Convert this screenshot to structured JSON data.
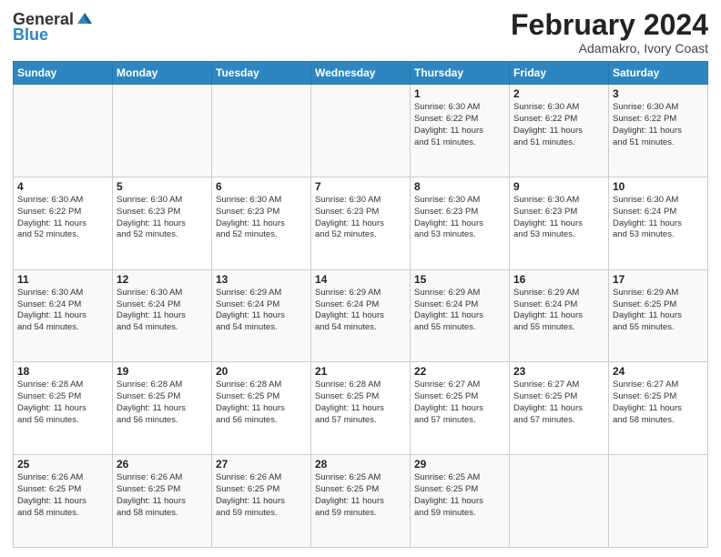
{
  "header": {
    "logo_line1": "General",
    "logo_line2": "Blue",
    "title": "February 2024",
    "subtitle": "Adamakro, Ivory Coast"
  },
  "weekdays": [
    "Sunday",
    "Monday",
    "Tuesday",
    "Wednesday",
    "Thursday",
    "Friday",
    "Saturday"
  ],
  "weeks": [
    [
      {
        "day": "",
        "info": ""
      },
      {
        "day": "",
        "info": ""
      },
      {
        "day": "",
        "info": ""
      },
      {
        "day": "",
        "info": ""
      },
      {
        "day": "1",
        "info": "Sunrise: 6:30 AM\nSunset: 6:22 PM\nDaylight: 11 hours\nand 51 minutes."
      },
      {
        "day": "2",
        "info": "Sunrise: 6:30 AM\nSunset: 6:22 PM\nDaylight: 11 hours\nand 51 minutes."
      },
      {
        "day": "3",
        "info": "Sunrise: 6:30 AM\nSunset: 6:22 PM\nDaylight: 11 hours\nand 51 minutes."
      }
    ],
    [
      {
        "day": "4",
        "info": "Sunrise: 6:30 AM\nSunset: 6:22 PM\nDaylight: 11 hours\nand 52 minutes."
      },
      {
        "day": "5",
        "info": "Sunrise: 6:30 AM\nSunset: 6:23 PM\nDaylight: 11 hours\nand 52 minutes."
      },
      {
        "day": "6",
        "info": "Sunrise: 6:30 AM\nSunset: 6:23 PM\nDaylight: 11 hours\nand 52 minutes."
      },
      {
        "day": "7",
        "info": "Sunrise: 6:30 AM\nSunset: 6:23 PM\nDaylight: 11 hours\nand 52 minutes."
      },
      {
        "day": "8",
        "info": "Sunrise: 6:30 AM\nSunset: 6:23 PM\nDaylight: 11 hours\nand 53 minutes."
      },
      {
        "day": "9",
        "info": "Sunrise: 6:30 AM\nSunset: 6:23 PM\nDaylight: 11 hours\nand 53 minutes."
      },
      {
        "day": "10",
        "info": "Sunrise: 6:30 AM\nSunset: 6:24 PM\nDaylight: 11 hours\nand 53 minutes."
      }
    ],
    [
      {
        "day": "11",
        "info": "Sunrise: 6:30 AM\nSunset: 6:24 PM\nDaylight: 11 hours\nand 54 minutes."
      },
      {
        "day": "12",
        "info": "Sunrise: 6:30 AM\nSunset: 6:24 PM\nDaylight: 11 hours\nand 54 minutes."
      },
      {
        "day": "13",
        "info": "Sunrise: 6:29 AM\nSunset: 6:24 PM\nDaylight: 11 hours\nand 54 minutes."
      },
      {
        "day": "14",
        "info": "Sunrise: 6:29 AM\nSunset: 6:24 PM\nDaylight: 11 hours\nand 54 minutes."
      },
      {
        "day": "15",
        "info": "Sunrise: 6:29 AM\nSunset: 6:24 PM\nDaylight: 11 hours\nand 55 minutes."
      },
      {
        "day": "16",
        "info": "Sunrise: 6:29 AM\nSunset: 6:24 PM\nDaylight: 11 hours\nand 55 minutes."
      },
      {
        "day": "17",
        "info": "Sunrise: 6:29 AM\nSunset: 6:25 PM\nDaylight: 11 hours\nand 55 minutes."
      }
    ],
    [
      {
        "day": "18",
        "info": "Sunrise: 6:28 AM\nSunset: 6:25 PM\nDaylight: 11 hours\nand 56 minutes."
      },
      {
        "day": "19",
        "info": "Sunrise: 6:28 AM\nSunset: 6:25 PM\nDaylight: 11 hours\nand 56 minutes."
      },
      {
        "day": "20",
        "info": "Sunrise: 6:28 AM\nSunset: 6:25 PM\nDaylight: 11 hours\nand 56 minutes."
      },
      {
        "day": "21",
        "info": "Sunrise: 6:28 AM\nSunset: 6:25 PM\nDaylight: 11 hours\nand 57 minutes."
      },
      {
        "day": "22",
        "info": "Sunrise: 6:27 AM\nSunset: 6:25 PM\nDaylight: 11 hours\nand 57 minutes."
      },
      {
        "day": "23",
        "info": "Sunrise: 6:27 AM\nSunset: 6:25 PM\nDaylight: 11 hours\nand 57 minutes."
      },
      {
        "day": "24",
        "info": "Sunrise: 6:27 AM\nSunset: 6:25 PM\nDaylight: 11 hours\nand 58 minutes."
      }
    ],
    [
      {
        "day": "25",
        "info": "Sunrise: 6:26 AM\nSunset: 6:25 PM\nDaylight: 11 hours\nand 58 minutes."
      },
      {
        "day": "26",
        "info": "Sunrise: 6:26 AM\nSunset: 6:25 PM\nDaylight: 11 hours\nand 58 minutes."
      },
      {
        "day": "27",
        "info": "Sunrise: 6:26 AM\nSunset: 6:25 PM\nDaylight: 11 hours\nand 59 minutes."
      },
      {
        "day": "28",
        "info": "Sunrise: 6:25 AM\nSunset: 6:25 PM\nDaylight: 11 hours\nand 59 minutes."
      },
      {
        "day": "29",
        "info": "Sunrise: 6:25 AM\nSunset: 6:25 PM\nDaylight: 11 hours\nand 59 minutes."
      },
      {
        "day": "",
        "info": ""
      },
      {
        "day": "",
        "info": ""
      }
    ]
  ]
}
